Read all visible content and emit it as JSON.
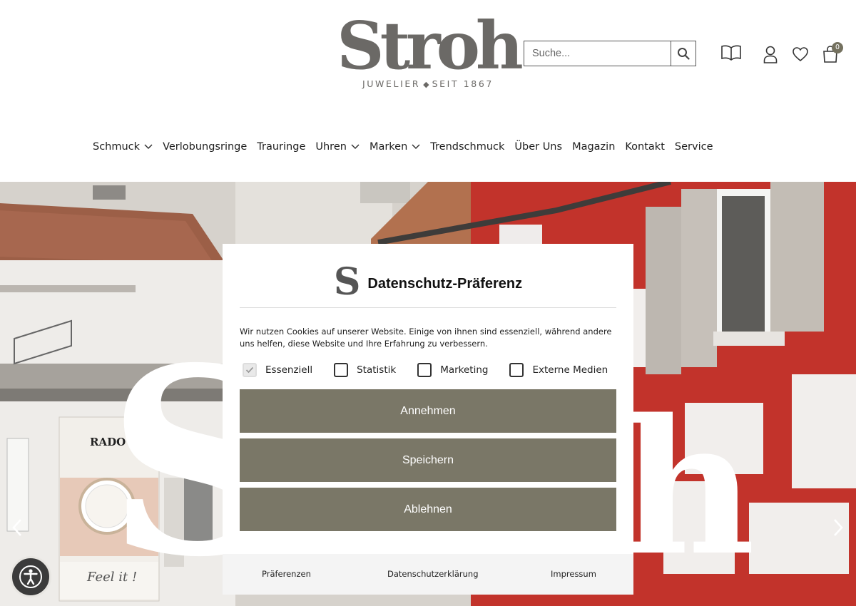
{
  "header": {
    "logo_word": "Stroh",
    "logo_tagline_left": "JUWELIER",
    "logo_tagline_right": "SEIT 1867",
    "search": {
      "placeholder": "Suche..."
    },
    "cart_count": "0",
    "icons": [
      "catalog-book-icon",
      "account-icon",
      "wishlist-heart-icon",
      "cart-bag-icon",
      "search-icon"
    ]
  },
  "nav": {
    "items": [
      {
        "label": "Schmuck",
        "dropdown": true
      },
      {
        "label": "Verlobungsringe",
        "dropdown": false
      },
      {
        "label": "Trauringe",
        "dropdown": false
      },
      {
        "label": "Uhren",
        "dropdown": true
      },
      {
        "label": "Marken",
        "dropdown": true
      },
      {
        "label": "Trendschmuck",
        "dropdown": false
      },
      {
        "label": "Über Uns",
        "dropdown": false
      },
      {
        "label": "Magazin",
        "dropdown": false
      },
      {
        "label": "Kontakt",
        "dropdown": false
      },
      {
        "label": "Service",
        "dropdown": false
      }
    ]
  },
  "hero": {
    "poster_brand": "RADO",
    "poster_tagline": "Feel it !"
  },
  "dialog": {
    "logo_letter": "S",
    "title": "Datenschutz-Präferenz",
    "text": "Wir nutzen Cookies auf unserer Website. Einige von ihnen sind essenziell, während andere uns helfen, diese Website und Ihre Erfahrung zu verbessern.",
    "checkboxes": [
      {
        "label": "Essenziell",
        "checked": true,
        "disabled": true
      },
      {
        "label": "Statistik",
        "checked": false,
        "disabled": false
      },
      {
        "label": "Marketing",
        "checked": false,
        "disabled": false
      },
      {
        "label": "Externe Medien",
        "checked": false,
        "disabled": false
      }
    ],
    "buttons": {
      "accept": "Annehmen",
      "save": "Speichern",
      "decline": "Ablehnen"
    },
    "footer_links": {
      "preferences": "Präferenzen",
      "privacy": "Datenschutzerklärung",
      "imprint": "Impressum"
    }
  },
  "colors": {
    "button_bg": "#7a7767",
    "logo_gray": "#6b6966",
    "badge_bg": "#74715f",
    "footer_bg": "#f4f4f4"
  }
}
